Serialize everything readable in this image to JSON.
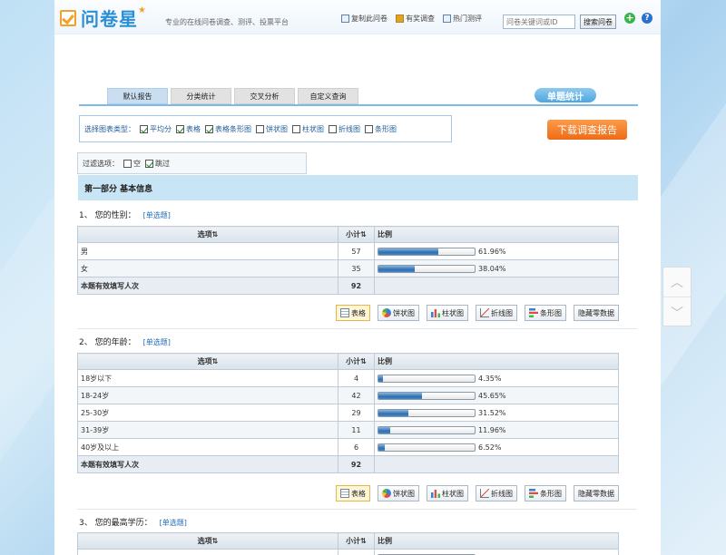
{
  "header": {
    "logo_text": "问卷星",
    "slogan": "专业的在线问卷调查、测评、投票平台",
    "links": [
      {
        "label": "复制此问卷",
        "icon": "copy-icon"
      },
      {
        "label": "有奖调查",
        "icon": "gift-icon"
      },
      {
        "label": "热门测评",
        "icon": "hot-icon"
      }
    ],
    "search_placeholder": "问卷关键词或ID",
    "search_button": "搜索问卷"
  },
  "tabs": [
    "默认报告",
    "分类统计",
    "交叉分析",
    "自定义查询"
  ],
  "single_stat_label": "单题统计",
  "chart_type": {
    "label": "选择图表类型：",
    "options": [
      {
        "label": "平均分",
        "checked": true
      },
      {
        "label": "表格",
        "checked": true
      },
      {
        "label": "表格条形图",
        "checked": true
      },
      {
        "label": "饼状图",
        "checked": false
      },
      {
        "label": "柱状图",
        "checked": false
      },
      {
        "label": "折线图",
        "checked": false
      },
      {
        "label": "条形图",
        "checked": false
      }
    ]
  },
  "download_label": "下载调查报告",
  "filter": {
    "label": "过滤选项：",
    "options": [
      {
        "label": "空",
        "checked": false
      },
      {
        "label": "跳过",
        "checked": true
      }
    ]
  },
  "section_title": "第一部分 基本信息",
  "table_headers": {
    "option": "选项",
    "count": "小计",
    "ratio": "比例"
  },
  "total_label": "本题有效填写人次",
  "toolbar": [
    "表格",
    "饼状图",
    "柱状图",
    "折线图",
    "条形图",
    "隐藏零数据"
  ],
  "toolbar_icons": [
    "table-icon",
    "pie-chart-icon",
    "column-chart-icon",
    "line-chart-icon",
    "bar-chart-icon",
    ""
  ],
  "questions": [
    {
      "title": "1、 您的性别：",
      "tag": "[单选题]",
      "rows": [
        {
          "option": "男",
          "count": "57",
          "pct": "61.96%",
          "value": 61.96
        },
        {
          "option": "女",
          "count": "35",
          "pct": "38.04%",
          "value": 38.04
        }
      ],
      "total": "92"
    },
    {
      "title": "2、 您的年龄：",
      "tag": "[单选题]",
      "rows": [
        {
          "option": "18岁以下",
          "count": "4",
          "pct": "4.35%",
          "value": 4.35
        },
        {
          "option": "18-24岁",
          "count": "42",
          "pct": "45.65%",
          "value": 45.65
        },
        {
          "option": "25-30岁",
          "count": "29",
          "pct": "31.52%",
          "value": 31.52
        },
        {
          "option": "31-39岁",
          "count": "11",
          "pct": "11.96%",
          "value": 11.96
        },
        {
          "option": "40岁及以上",
          "count": "6",
          "pct": "6.52%",
          "value": 6.52
        }
      ],
      "total": "92"
    },
    {
      "title": "3、 您的最高学历：",
      "tag": "[单选题]",
      "rows": [],
      "total": ""
    }
  ]
}
